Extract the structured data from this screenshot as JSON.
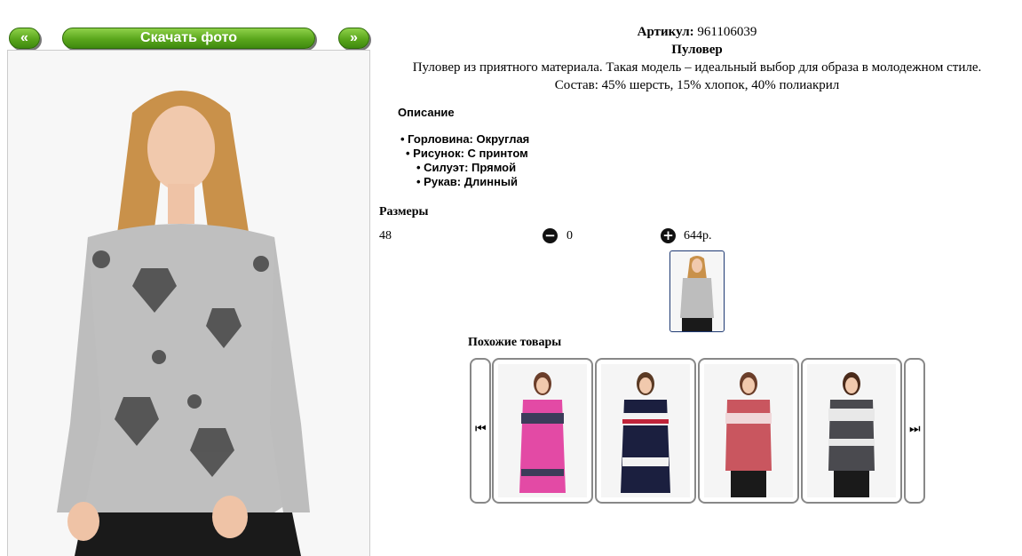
{
  "nav": {
    "prev_label": "«",
    "download_label": "Скачать фото",
    "next_label": "»"
  },
  "product": {
    "article_label": "Артикул:",
    "article_value": "961106039",
    "name": "Пуловер",
    "description": "Пуловер из приятного материала. Такая модель – идеальный выбор для образа в молодежном стиле.",
    "composition": "Состав: 45% шерсть, 15% хлопок, 40% полиакрил"
  },
  "specs": {
    "title": "Описание",
    "items": [
      {
        "label": "Горловина: Округлая"
      },
      {
        "label": "Рисунок: С принтом"
      },
      {
        "label": "Силуэт: Прямой"
      },
      {
        "label": "Рукав: Длинный"
      }
    ]
  },
  "sizes": {
    "title": "Размеры",
    "rows": [
      {
        "size": "48",
        "quantity": "0",
        "price": "644р."
      }
    ]
  },
  "similar": {
    "title": "Похожие товары"
  },
  "colors": {
    "green_button": "#5aa61c",
    "thumb_border": "#1f3a73",
    "card_border": "#888888"
  }
}
